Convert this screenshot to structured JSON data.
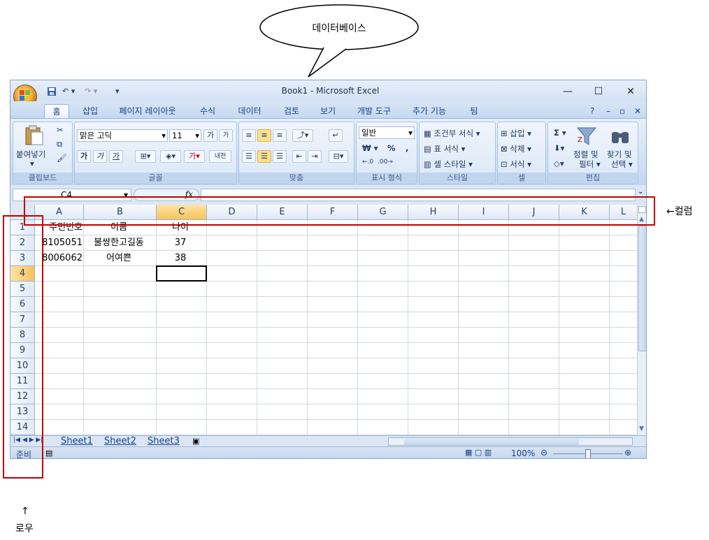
{
  "annotations": {
    "bubble_text": "데이터베이스",
    "column_label": "←컬럼",
    "row_arrow": "↑",
    "row_label": "로우"
  },
  "window": {
    "title": "Book1 - Microsoft Excel",
    "controls": {
      "minimize": "—",
      "maximize": "☐",
      "close": "✕"
    }
  },
  "tabs": [
    "홈",
    "삽입",
    "페이지 레이아웃",
    "수식",
    "데이터",
    "검토",
    "보기",
    "개발 도구",
    "추가 기능",
    "팀"
  ],
  "active_tab": "홈",
  "ribbon": {
    "clipboard": {
      "paste_label": "붙여넣기",
      "group_label": "클립보드"
    },
    "font": {
      "font_name": "맑은 고딕",
      "font_size": "11",
      "group_label": "글꼴",
      "bold": "가",
      "italic": "가",
      "underline": "가",
      "grow": "가",
      "shrink": "가",
      "font_color": "가",
      "phonetic": "내천"
    },
    "alignment": {
      "group_label": "맞춤"
    },
    "number": {
      "format": "일반",
      "currency": "₩",
      "percent": "%",
      "comma": ",",
      "group_label": "표시 형식"
    },
    "styles": {
      "conditional": "조건부 서식",
      "table": "표 서식",
      "cell": "셀 스타일",
      "group_label": "스타일"
    },
    "cells": {
      "insert": "삽입",
      "delete": "삭제",
      "format": "서식",
      "group_label": "셀"
    },
    "editing": {
      "sigma": "Σ",
      "sort": "정렬 및",
      "sort2": "필터",
      "find": "찾기 및",
      "find2": "선택",
      "group_label": "편집"
    }
  },
  "formula_bar": {
    "name_box": "C4",
    "fx": "fx"
  },
  "columns": [
    "A",
    "B",
    "C",
    "D",
    "E",
    "F",
    "G",
    "H",
    "I",
    "J",
    "K",
    "L"
  ],
  "rows": [
    "1",
    "2",
    "3",
    "4",
    "5",
    "6",
    "7",
    "8",
    "9",
    "10",
    "11",
    "12",
    "13",
    "14"
  ],
  "cells": {
    "A1": "주민번호",
    "B1": "이름",
    "C1": "나이",
    "A2": "8105051",
    "B2": "불쌍한고길동",
    "C2": "37",
    "A3": "8006062",
    "B3": "어여쁜",
    "C3": "38"
  },
  "selected_cell": "C4",
  "sheets": [
    "Sheet1",
    "Sheet2",
    "Sheet3"
  ],
  "status": {
    "ready": "준비",
    "zoom": "100%"
  },
  "colors": {
    "annotation_red": "#c00000",
    "selection": "#f7c25d"
  }
}
